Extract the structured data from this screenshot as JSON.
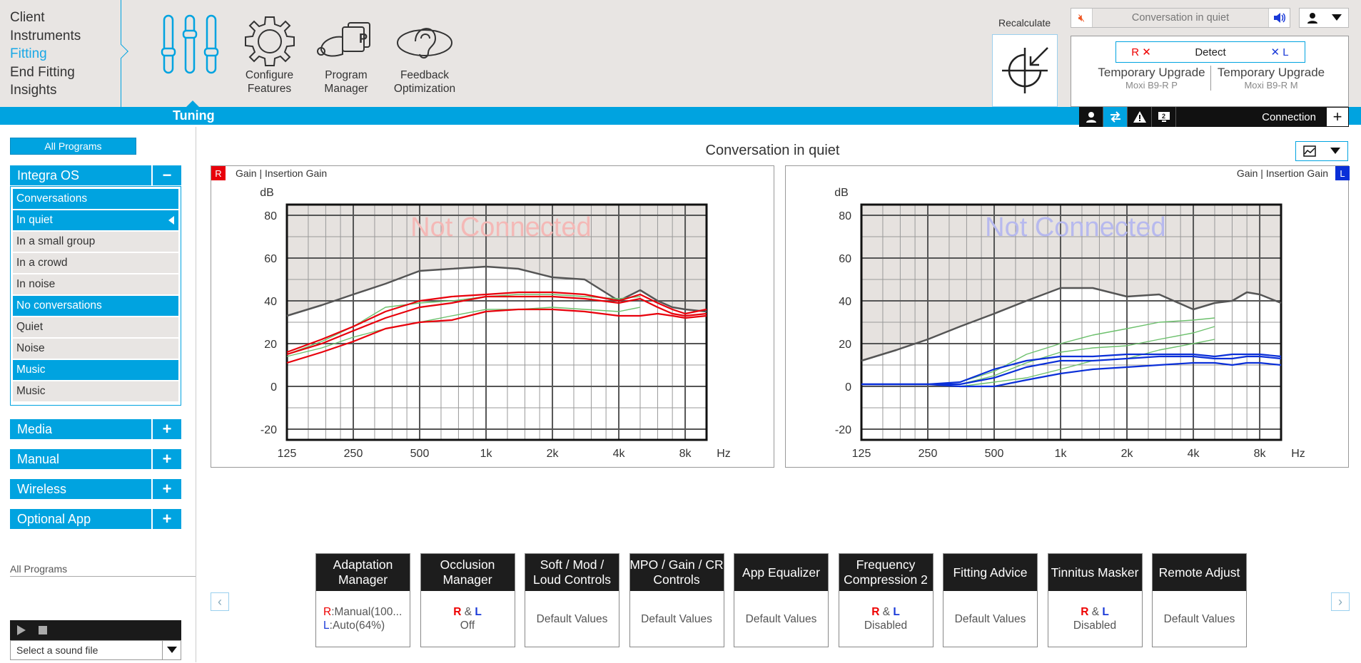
{
  "nav": {
    "items": [
      "Client",
      "Instruments",
      "Fitting",
      "End Fitting",
      "Insights"
    ],
    "active": "Fitting"
  },
  "tools": [
    {
      "label": "",
      "icon": "sliders-icon"
    },
    {
      "label": "Configure\nFeatures",
      "icon": "gear-icon"
    },
    {
      "label": "Program\nManager",
      "icon": "program-manager-icon"
    },
    {
      "label": "Feedback\nOptimization",
      "icon": "feedback-ear-icon"
    }
  ],
  "recalc_label": "Recalculate",
  "tuning_label": "Tuning",
  "program_bar": {
    "name": "Conversation in quiet"
  },
  "device": {
    "right_mark": "R ✕",
    "detect": "Detect",
    "left_mark": "✕ L",
    "right": {
      "title": "Temporary Upgrade",
      "model": "Moxi B9-R P"
    },
    "left": {
      "title": "Temporary Upgrade",
      "model": "Moxi B9-R M"
    }
  },
  "connection_label": "Connection",
  "sidebar": {
    "all_programs": "All Programs",
    "group_main": "Integra OS",
    "sublist": [
      {
        "label": "Conversations",
        "kind": "hd"
      },
      {
        "label": "In quiet",
        "kind": "sel"
      },
      {
        "label": "In a small group",
        "kind": ""
      },
      {
        "label": "In a crowd",
        "kind": ""
      },
      {
        "label": "In noise",
        "kind": ""
      },
      {
        "label": "No conversations",
        "kind": "hd"
      },
      {
        "label": "Quiet",
        "kind": ""
      },
      {
        "label": "Noise",
        "kind": ""
      },
      {
        "label": "Music",
        "kind": "hd"
      },
      {
        "label": "Music",
        "kind": ""
      }
    ],
    "groups": [
      "Media",
      "Manual",
      "Wireless",
      "Optional App"
    ],
    "all_programs_small": "All Programs",
    "sound_file": "Select a sound file"
  },
  "chart_title": "Conversation in quiet",
  "colors": {
    "accent": "#00a3e0",
    "right": "#e8000b",
    "left": "#0a2fd8",
    "target": "#6cc06c",
    "limit": "#555555"
  },
  "chart_data": [
    {
      "type": "line",
      "side": "R",
      "header": "Gain | Insertion Gain",
      "watermark": "Not Connected",
      "ylabel": "dB",
      "xlabel": "Hz",
      "x_ticks": [
        "125",
        "250",
        "500",
        "1k",
        "2k",
        "4k",
        "8k"
      ],
      "x": [
        125,
        180,
        250,
        350,
        500,
        700,
        1000,
        1400,
        2000,
        2800,
        4000,
        5000,
        6000,
        7000,
        8000,
        10000
      ],
      "ylim": [
        -25,
        85
      ],
      "y_ticks": [
        80,
        60,
        40,
        20,
        0,
        -20
      ],
      "series": [
        {
          "role": "limit",
          "values": [
            33,
            38,
            43,
            48,
            54,
            55,
            56,
            55,
            51,
            50,
            40,
            45,
            40,
            37,
            36,
            35
          ]
        },
        {
          "role": "target",
          "values": [
            15,
            21,
            28,
            37,
            39,
            40,
            42,
            43,
            43,
            42,
            41,
            42,
            null,
            null,
            null,
            null
          ]
        },
        {
          "role": "target",
          "values": [
            14,
            18,
            23,
            27,
            30,
            33,
            36,
            36,
            37,
            36,
            35,
            37,
            null,
            null,
            null,
            null
          ]
        },
        {
          "role": "fitted",
          "values": [
            16,
            22,
            28,
            35,
            40,
            42,
            43,
            44,
            44,
            43,
            40,
            43,
            39,
            36,
            34,
            36
          ]
        },
        {
          "role": "fitted",
          "values": [
            15,
            20,
            26,
            32,
            37,
            39,
            42,
            42,
            42,
            41,
            39,
            41,
            37,
            34,
            33,
            34
          ]
        },
        {
          "role": "fitted",
          "values": [
            11,
            16,
            21,
            27,
            30,
            31,
            35,
            36,
            36,
            35,
            33,
            33,
            34,
            33,
            32,
            33
          ]
        }
      ]
    },
    {
      "type": "line",
      "side": "L",
      "header": "Gain | Insertion Gain",
      "watermark": "Not Connected",
      "ylabel": "dB",
      "xlabel": "Hz",
      "x_ticks": [
        "125",
        "250",
        "500",
        "1k",
        "2k",
        "4k",
        "8k"
      ],
      "x": [
        125,
        180,
        250,
        350,
        500,
        700,
        1000,
        1400,
        2000,
        2800,
        4000,
        5000,
        6000,
        7000,
        8000,
        10000
      ],
      "ylim": [
        -25,
        85
      ],
      "y_ticks": [
        80,
        60,
        40,
        20,
        0,
        -20
      ],
      "series": [
        {
          "role": "limit",
          "values": [
            12,
            17,
            22,
            28,
            34,
            40,
            46,
            46,
            42,
            43,
            36,
            39,
            40,
            44,
            43,
            39
          ]
        },
        {
          "role": "target",
          "values": [
            null,
            null,
            null,
            2,
            7,
            15,
            20,
            24,
            27,
            30,
            31,
            32,
            null,
            null,
            null,
            null
          ]
        },
        {
          "role": "target",
          "values": [
            null,
            null,
            null,
            1,
            5,
            11,
            16,
            18,
            19,
            22,
            25,
            28,
            null,
            null,
            null,
            null
          ]
        },
        {
          "role": "target",
          "values": [
            null,
            null,
            null,
            0,
            2,
            4,
            8,
            12,
            13,
            17,
            20,
            22,
            null,
            null,
            null,
            null
          ]
        },
        {
          "role": "fitted",
          "values": [
            1,
            1,
            1,
            2,
            8,
            12,
            14,
            14,
            15,
            15,
            15,
            14,
            15,
            15,
            15,
            14
          ]
        },
        {
          "role": "fitted",
          "values": [
            1,
            1,
            1,
            1,
            4,
            9,
            12,
            12,
            13,
            14,
            14,
            13,
            13,
            14,
            14,
            13
          ]
        },
        {
          "role": "fitted",
          "values": [
            1,
            1,
            1,
            0,
            0,
            3,
            6,
            8,
            9,
            10,
            11,
            11,
            10,
            11,
            11,
            10
          ]
        }
      ]
    }
  ],
  "tiles": [
    {
      "title": "Adaptation\nManager",
      "value_r": "Manual(100...",
      "value_l": "Auto(64%)",
      "kind": "rl-lines"
    },
    {
      "title": "Occlusion\nManager",
      "value": "Off",
      "kind": "rl"
    },
    {
      "title": "Soft / Mod /\nLoud Controls",
      "value": "Default Values",
      "kind": "plain"
    },
    {
      "title": "MPO / Gain / CR\nControls",
      "value": "Default Values",
      "kind": "plain"
    },
    {
      "title": "App Equalizer",
      "value": "Default Values",
      "kind": "plain"
    },
    {
      "title": "Frequency\nCompression 2",
      "value": "Disabled",
      "kind": "rl"
    },
    {
      "title": "Fitting Advice",
      "value": "Default Values",
      "kind": "plain"
    },
    {
      "title": "Tinnitus Masker",
      "value": "Disabled",
      "kind": "rl"
    },
    {
      "title": "Remote Adjust",
      "value": "Default Values",
      "kind": "plain"
    }
  ]
}
